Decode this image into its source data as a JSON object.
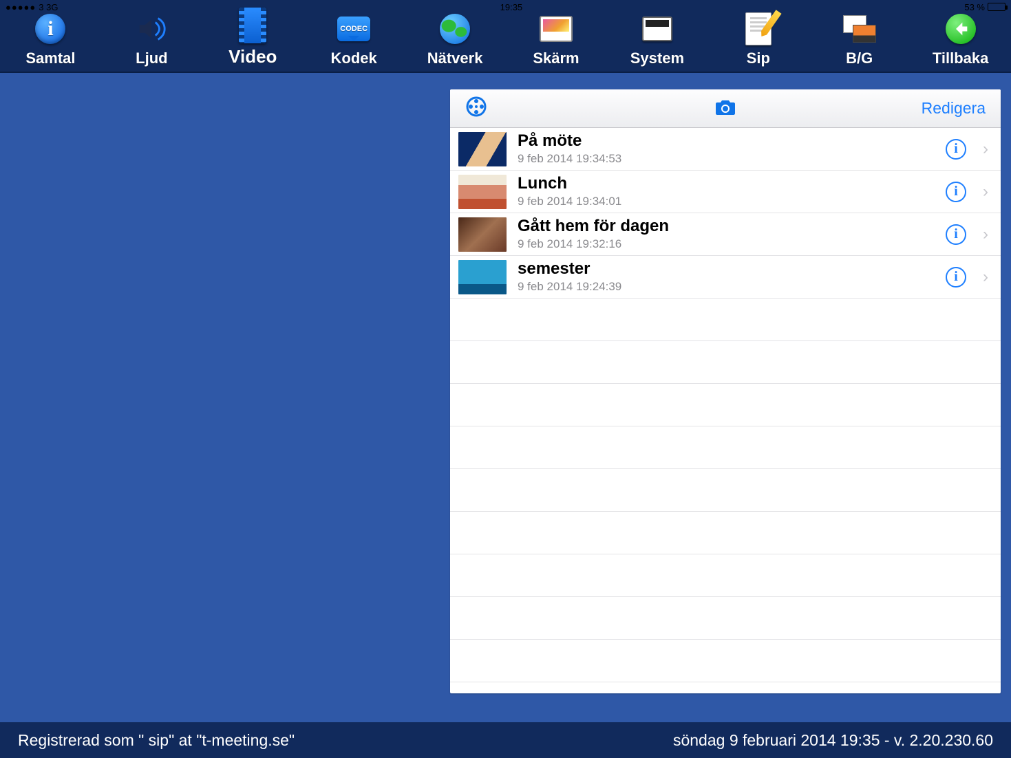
{
  "statusbar": {
    "carrier": "3  3G",
    "time": "19:35",
    "battery": "53 %"
  },
  "tabs": [
    {
      "id": "samtal",
      "label": "Samtal"
    },
    {
      "id": "ljud",
      "label": "Ljud"
    },
    {
      "id": "video",
      "label": "Video"
    },
    {
      "id": "kodek",
      "label": "Kodek"
    },
    {
      "id": "natverk",
      "label": "Nätverk"
    },
    {
      "id": "skarm",
      "label": "Skärm"
    },
    {
      "id": "system",
      "label": "System"
    },
    {
      "id": "sip",
      "label": "Sip"
    },
    {
      "id": "bg",
      "label": "B/G"
    },
    {
      "id": "tillbaka",
      "label": "Tillbaka"
    }
  ],
  "panel": {
    "edit_label": "Redigera",
    "items": [
      {
        "title": "På möte",
        "sub": "9 feb 2014 19:34:53"
      },
      {
        "title": "Lunch",
        "sub": "9 feb 2014 19:34:01"
      },
      {
        "title": "Gått hem för dagen",
        "sub": "9 feb 2014 19:32:16"
      },
      {
        "title": "semester",
        "sub": "9 feb 2014 19:24:39"
      }
    ]
  },
  "footer": {
    "left": "Registrerad som \" sip\" at \"t-meeting.se\"",
    "right": "söndag 9 februari 2014 19:35 - v. 2.20.230.60"
  },
  "codec_text": "CODEC"
}
